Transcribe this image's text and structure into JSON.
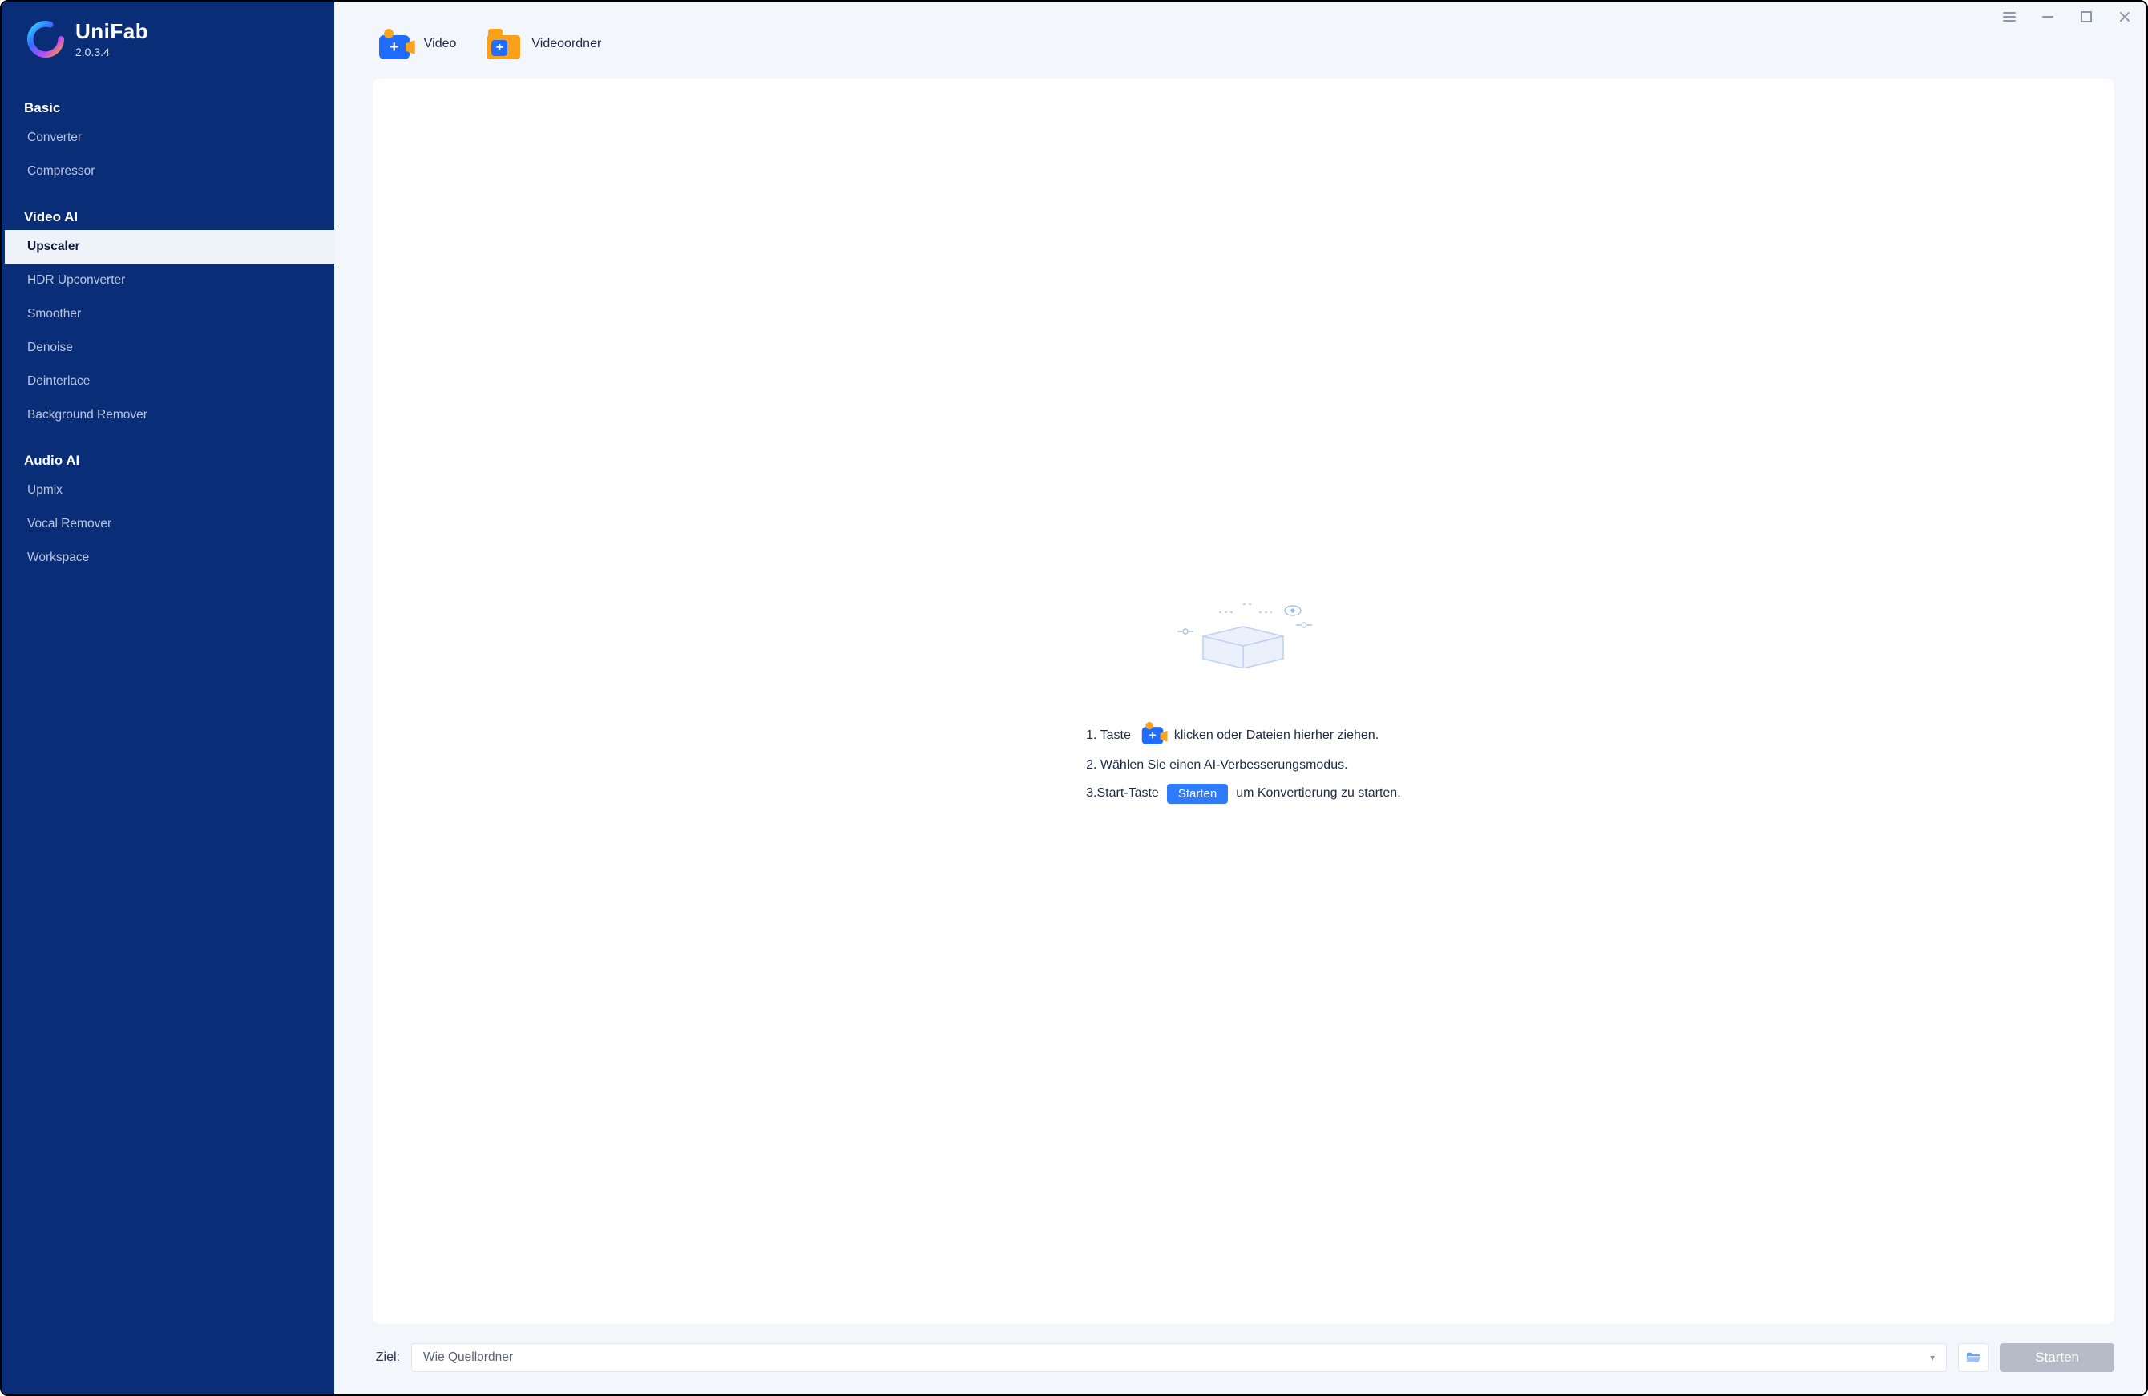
{
  "brand": {
    "name": "UniFab",
    "version": "2.0.3.4"
  },
  "sidebar": {
    "sections": [
      {
        "title": "Basic",
        "items": [
          "Converter",
          "Compressor"
        ]
      },
      {
        "title": "Video AI",
        "items": [
          "Upscaler",
          "HDR Upconverter",
          "Smoother",
          "Denoise",
          "Deinterlace",
          "Background Remover"
        ]
      },
      {
        "title": "Audio AI",
        "items": [
          "Upmix",
          "Vocal Remover"
        ]
      }
    ],
    "active": "Upscaler",
    "footer_item": "Workspace"
  },
  "toolbar": {
    "video": {
      "label": "Video"
    },
    "folder": {
      "label": "Videoordner"
    }
  },
  "placeholder": {
    "step1_a": "1. Taste",
    "step1_b": "klicken oder Dateien hierher ziehen.",
    "step2": "2. Wählen Sie einen AI-Verbesserungsmodus.",
    "step3_a": "3.Start-Taste",
    "step3_pill": "Starten",
    "step3_b": "um Konvertierung zu starten."
  },
  "bottom": {
    "label": "Ziel:",
    "dest_value": "Wie Quellordner",
    "start_label": "Starten"
  },
  "colors": {
    "accent": "#206cff",
    "sidebar": "#0a2d78"
  }
}
